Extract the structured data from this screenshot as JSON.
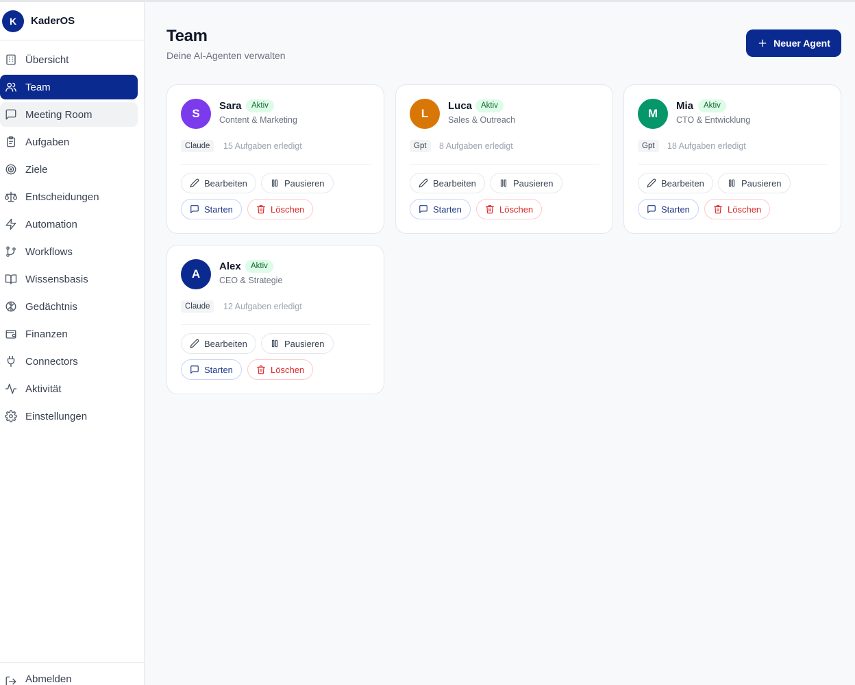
{
  "app": {
    "logo_letter": "K",
    "name": "KaderOS"
  },
  "sidebar": {
    "items": [
      {
        "label": "Übersicht",
        "icon": "building-icon",
        "state": ""
      },
      {
        "label": "Team",
        "icon": "users-icon",
        "state": "active"
      },
      {
        "label": "Meeting Room",
        "icon": "message-square-icon",
        "state": "hover"
      },
      {
        "label": "Aufgaben",
        "icon": "clipboard-icon",
        "state": ""
      },
      {
        "label": "Ziele",
        "icon": "target-icon",
        "state": ""
      },
      {
        "label": "Entscheidungen",
        "icon": "scale-icon",
        "state": ""
      },
      {
        "label": "Automation",
        "icon": "zap-icon",
        "state": ""
      },
      {
        "label": "Workflows",
        "icon": "git-branch-icon",
        "state": ""
      },
      {
        "label": "Wissensbasis",
        "icon": "book-open-icon",
        "state": ""
      },
      {
        "label": "Gedächtnis",
        "icon": "brain-icon",
        "state": ""
      },
      {
        "label": "Finanzen",
        "icon": "wallet-icon",
        "state": ""
      },
      {
        "label": "Connectors",
        "icon": "plug-icon",
        "state": ""
      },
      {
        "label": "Aktivität",
        "icon": "activity-icon",
        "state": ""
      },
      {
        "label": "Einstellungen",
        "icon": "gear-icon",
        "state": ""
      }
    ],
    "logout_label": "Abmelden"
  },
  "header": {
    "title": "Team",
    "subtitle": "Deine AI-Agenten verwalten",
    "new_agent_label": "Neuer Agent"
  },
  "buttons": {
    "edit": "Bearbeiten",
    "pause": "Pausieren",
    "start": "Starten",
    "delete": "Löschen"
  },
  "agents": [
    {
      "initial": "S",
      "name": "Sara",
      "status": "Aktiv",
      "role": "Content & Marketing",
      "model": "Claude",
      "tasks": "15 Aufgaben erledigt",
      "color": "#7c3aed"
    },
    {
      "initial": "L",
      "name": "Luca",
      "status": "Aktiv",
      "role": "Sales & Outreach",
      "model": "Gpt",
      "tasks": "8 Aufgaben erledigt",
      "color": "#d97706"
    },
    {
      "initial": "M",
      "name": "Mia",
      "status": "Aktiv",
      "role": "CTO & Entwicklung",
      "model": "Gpt",
      "tasks": "18 Aufgaben erledigt",
      "color": "#059669"
    },
    {
      "initial": "A",
      "name": "Alex",
      "status": "Aktiv",
      "role": "CEO & Strategie",
      "model": "Claude",
      "tasks": "12 Aufgaben erledigt",
      "color": "#0b2a8f"
    }
  ],
  "colors": {
    "accent": "#0b2a8f",
    "status_bg": "#dcfce7",
    "danger": "#dc2626"
  }
}
